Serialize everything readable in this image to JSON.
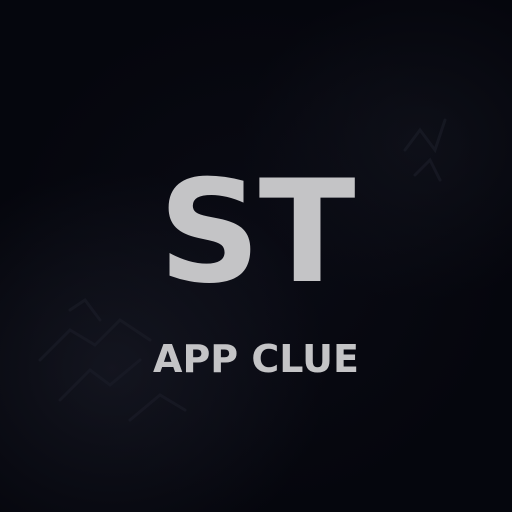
{
  "logo": {
    "initials": "ST",
    "subtitle": "APP CLUE"
  },
  "colors": {
    "background": "#05060d",
    "text": "#c4c4c6"
  }
}
